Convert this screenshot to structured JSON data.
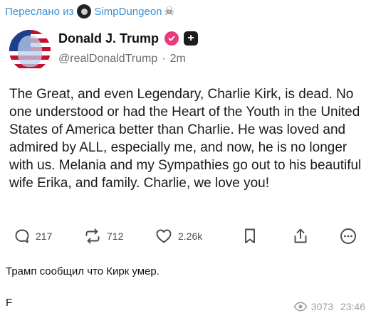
{
  "forward": {
    "prefix": "Переслано из",
    "channel": "SimpDungeon",
    "skull": "☠"
  },
  "post": {
    "author_name": "Donald J. Trump",
    "handle": "@realDonaldTrump",
    "separator": "·",
    "age": "2m",
    "plus_badge": "+",
    "text": "The Great, and even Legendary, Charlie Kirk, is dead. No one understood or had the Heart of the Youth in the United States of America better than Charlie. He was loved and admired by ALL, especially me, and now, he is no longer with us. Melania and my Sympathies go out to his beautiful wife Erika, and family. Charlie, we love you!",
    "actions": {
      "replies": "217",
      "reposts": "712",
      "likes": "2.26k"
    }
  },
  "message": {
    "caption": "Трамп сообщил что Кирк умер.",
    "tail": "F",
    "views": "3073",
    "time": "23:46"
  },
  "colors": {
    "accent": "#3a8fd4",
    "verified": "#e83c7a",
    "meta": "#9aa0a6"
  },
  "icons": [
    "user-avatar-icon",
    "skull-icon",
    "verified-icon",
    "plus-icon",
    "reply-icon",
    "repost-icon",
    "like-icon",
    "bookmark-icon",
    "share-icon",
    "more-icon",
    "eye-icon"
  ]
}
